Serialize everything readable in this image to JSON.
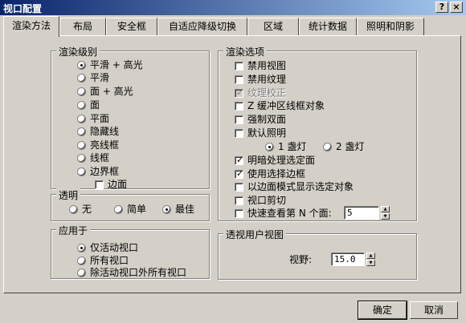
{
  "window": {
    "title": "视口配置",
    "help_label": "?",
    "close_label": "×"
  },
  "tabs": [
    {
      "label": "渲染方法",
      "active": true
    },
    {
      "label": "布局",
      "active": false
    },
    {
      "label": "安全框",
      "active": false
    },
    {
      "label": "自适应降级切换",
      "active": false
    },
    {
      "label": "区域",
      "active": false
    },
    {
      "label": "统计数据",
      "active": false
    },
    {
      "label": "照明和阴影",
      "active": false
    }
  ],
  "render_level": {
    "title": "渲染级别",
    "options": [
      {
        "label": "平滑 + 高光",
        "selected": true
      },
      {
        "label": "平滑",
        "selected": false
      },
      {
        "label": "面 + 高光",
        "selected": false
      },
      {
        "label": "面",
        "selected": false
      },
      {
        "label": "平面",
        "selected": false
      },
      {
        "label": "隐藏线",
        "selected": false
      },
      {
        "label": "亮线框",
        "selected": false
      },
      {
        "label": "线框",
        "selected": false
      },
      {
        "label": "边界框",
        "selected": false
      }
    ],
    "edged_faces": {
      "label": "边面",
      "checked": false
    }
  },
  "transparency": {
    "title": "透明",
    "options": [
      {
        "label": "无",
        "selected": false
      },
      {
        "label": "简单",
        "selected": false
      },
      {
        "label": "最佳",
        "selected": true
      }
    ]
  },
  "apply_to": {
    "title": "应用于",
    "options": [
      {
        "label": "仅活动视口",
        "selected": true
      },
      {
        "label": "所有视口",
        "selected": false
      },
      {
        "label": "除活动视口外所有视口",
        "selected": false
      }
    ]
  },
  "render_options": {
    "title": "渲染选项",
    "items": [
      {
        "label": "禁用视图",
        "checked": false,
        "disabled": false
      },
      {
        "label": "禁用纹理",
        "checked": false,
        "disabled": false
      },
      {
        "label": "纹理校正",
        "checked": true,
        "disabled": true
      },
      {
        "label": "Z 缓冲区线框对象",
        "checked": false,
        "disabled": false
      },
      {
        "label": "强制双面",
        "checked": false,
        "disabled": false
      },
      {
        "label": "默认照明",
        "checked": false,
        "disabled": false
      }
    ],
    "lights": [
      {
        "label": "1 盏灯",
        "selected": true
      },
      {
        "label": "2 盏灯",
        "selected": false
      }
    ],
    "items2": [
      {
        "label": "明暗处理选定面",
        "checked": true
      },
      {
        "label": "使用选择边框",
        "checked": true
      },
      {
        "label": "以边面模式显示选定对象",
        "checked": false
      },
      {
        "label": "视口剪切",
        "checked": false
      },
      {
        "label": "快速查看第 N 个面:",
        "checked": false
      }
    ],
    "nth_face_value": "5"
  },
  "perspective": {
    "title": "透视用户视图",
    "fov_label": "视野:",
    "fov_value": "15.0"
  },
  "buttons": {
    "ok": "确定",
    "cancel": "取消"
  }
}
